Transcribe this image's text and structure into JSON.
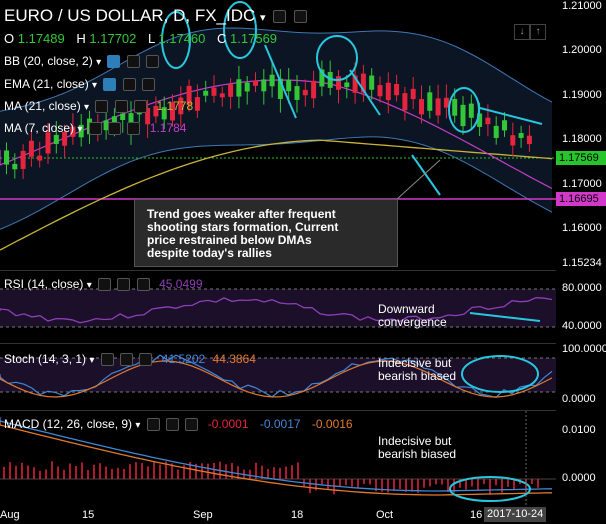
{
  "header": {
    "title": "EURO / US DOLLAR, D, FX_IDC",
    "ohlc": [
      {
        "k": "O",
        "v": "1.17489"
      },
      {
        "k": "H",
        "v": "1.17702"
      },
      {
        "k": "L",
        "v": "1.17460"
      },
      {
        "k": "C",
        "v": "1.17569"
      }
    ]
  },
  "indicators": {
    "bb": {
      "label": "BB (20, close, 2)"
    },
    "ema": {
      "label": "EMA (21, close)"
    },
    "ma21": {
      "label": "MA (21, close)",
      "value": "1.1778"
    },
    "ma7": {
      "label": "MA (7, close)",
      "value": "1.1784"
    }
  },
  "price_axis": {
    "ticks": [
      "1.21000",
      "1.20000",
      "1.19000",
      "1.18000",
      "1.17000",
      "1.16000",
      "1.15234"
    ],
    "last_price": "1.17569",
    "level_price": "1.16695",
    "colors": {
      "last": "#26c52b",
      "level": "#d238c9"
    }
  },
  "annotation_main": {
    "lines": [
      "Trend goes weaker after frequent",
      "shooting stars formation, Current",
      "price restrained below DMAs",
      "despite today's rallies"
    ]
  },
  "rsi": {
    "label": "RSI (14, close)",
    "value": "45.0499",
    "ticks": [
      "80.0000",
      "40.0000"
    ],
    "note": [
      "Downward",
      "convergence"
    ]
  },
  "stoch": {
    "label": "Stoch (14, 3, 1)",
    "k": "41.5202",
    "d": "44.3864",
    "ticks": [
      "100.0000",
      "0.0000"
    ],
    "note": [
      "Indecisive but",
      "bearish biased"
    ]
  },
  "macd": {
    "label": "MACD (12, 26, close, 9)",
    "values": [
      "-0.0001",
      "-0.0017",
      "-0.0016"
    ],
    "ticks": [
      "0.0100",
      "0.0000"
    ],
    "note": [
      "Indecisive but",
      "bearish biased"
    ]
  },
  "time_axis": {
    "labels": [
      "Aug",
      "15",
      "Sep",
      "18",
      "Oct",
      "16"
    ],
    "current_date": "2017-10-24"
  },
  "toolbar": {
    "arrow_down": "↓",
    "arrow_up": "↑"
  },
  "colors": {
    "up": "#33c738",
    "down": "#e5243d",
    "cyan": "#28c7e0",
    "bb": "#3f78b5",
    "ema": "#c9b43a",
    "ma": "#c33ec7"
  }
}
